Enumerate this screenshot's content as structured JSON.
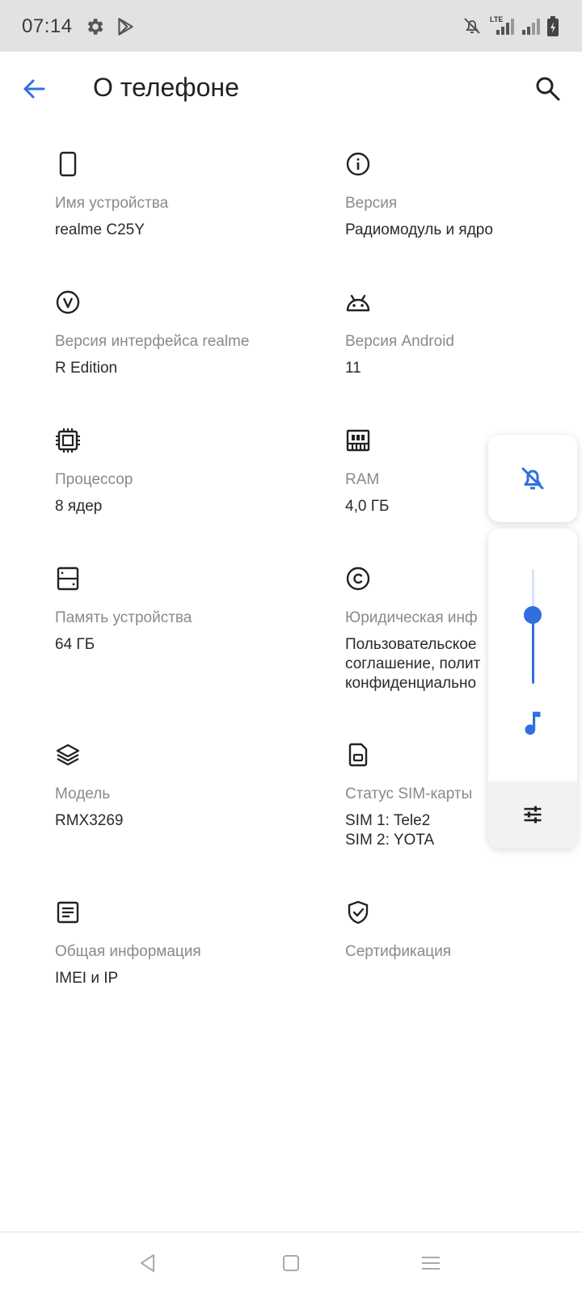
{
  "status_bar": {
    "time": "07:14",
    "network": "LTE",
    "icons": [
      "gear-icon",
      "play-store-icon",
      "bell-off-icon",
      "signal-icon",
      "signal-icon",
      "battery-charging-icon"
    ]
  },
  "header": {
    "title": "О телефоне",
    "back_icon": "arrow-back-icon",
    "search_icon": "search-icon"
  },
  "items": [
    {
      "icon": "phone-icon",
      "label": "Имя устройства",
      "value": "realme C25Y"
    },
    {
      "icon": "info-icon",
      "label": "Версия",
      "value": "Радиомодуль и ядро"
    },
    {
      "icon": "ui-version-icon",
      "label": "Версия интерфейса realme",
      "value": "R Edition"
    },
    {
      "icon": "android-icon",
      "label": "Версия Android",
      "value": "11"
    },
    {
      "icon": "processor-icon",
      "label": "Процессор",
      "value": "8 ядер"
    },
    {
      "icon": "ram-icon",
      "label": "RAM",
      "value": "4,0 ГБ"
    },
    {
      "icon": "storage-icon",
      "label": "Память устройства",
      "value": "64 ГБ"
    },
    {
      "icon": "copyright-icon",
      "label": "Юридическая инф",
      "value_lines": [
        "Пользовательское",
        "соглашение, полит",
        "конфиденциально"
      ]
    },
    {
      "icon": "layers-icon",
      "label": "Модель",
      "value": "RMX3269"
    },
    {
      "icon": "sim-card-icon",
      "label": "Статус SIM-карты",
      "value_lines": [
        "SIM 1: Tele2",
        "SIM 2: YOTA"
      ]
    },
    {
      "icon": "document-icon",
      "label": "Общая информация",
      "value": "IMEI и IP"
    },
    {
      "icon": "shield-check-icon",
      "label": "Сертификация",
      "value": ""
    }
  ],
  "volume_panel": {
    "ringer_icon": "bell-off-icon",
    "stream_icon": "music-note-icon",
    "settings_icon": "tune-icon",
    "level": 0.6,
    "accent_color": "#2f6fe0"
  },
  "nav_bar": {
    "icons": [
      "back-triangle-icon",
      "home-square-icon",
      "menu-lines-icon"
    ]
  }
}
